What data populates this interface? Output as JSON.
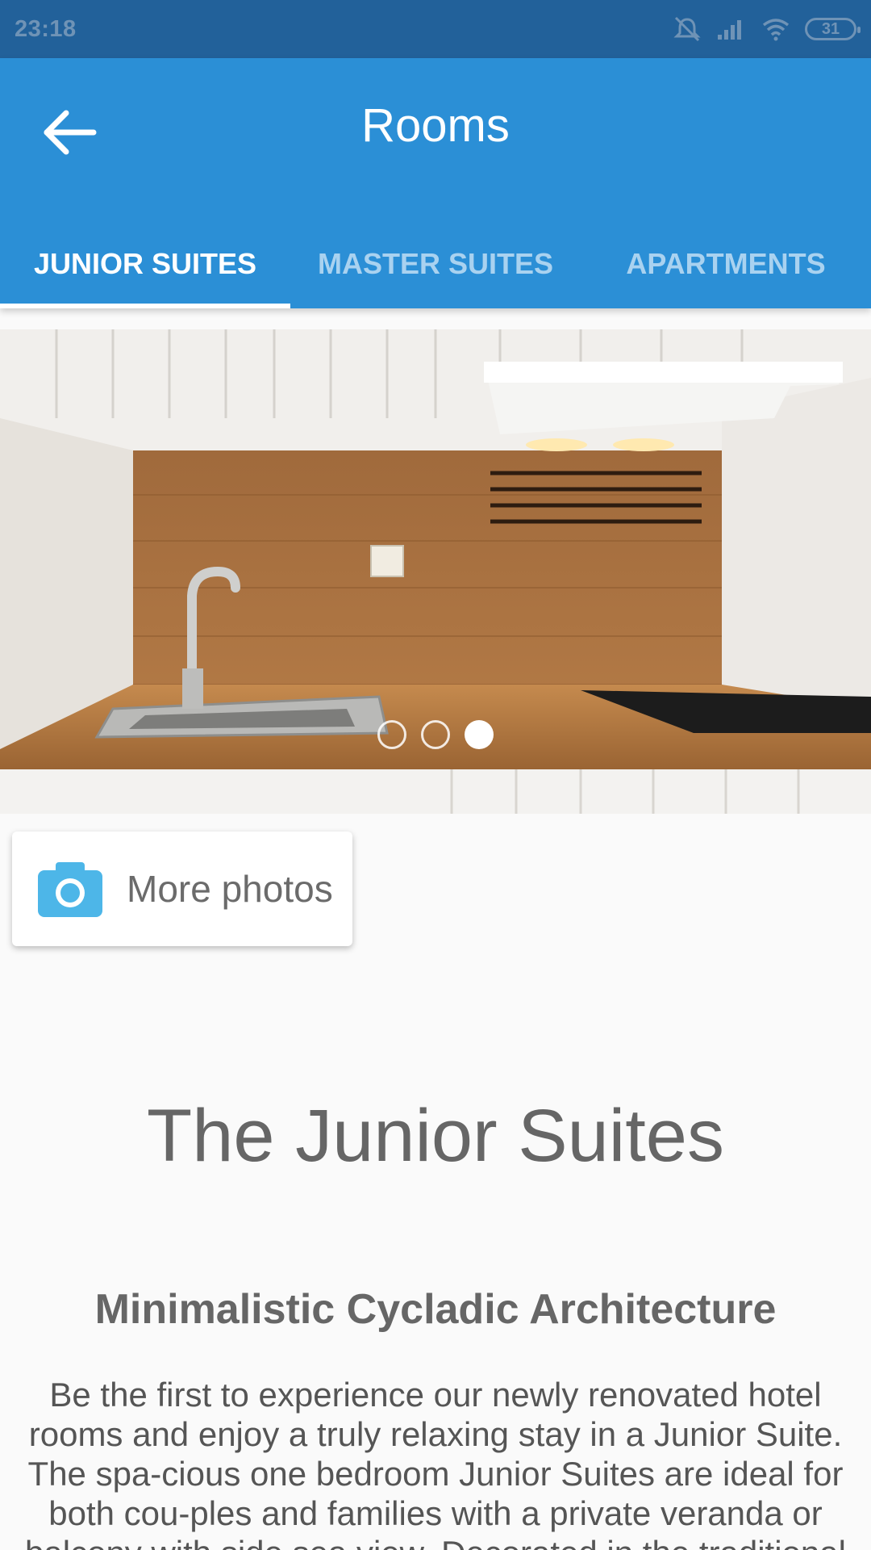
{
  "status_bar": {
    "time": "23:18",
    "battery": "31"
  },
  "app_bar": {
    "title": "Rooms"
  },
  "tabs": [
    {
      "label": "JUNIOR SUITES",
      "active": true
    },
    {
      "label": "MASTER SUITES",
      "active": false
    },
    {
      "label": "APARTMENTS",
      "active": false
    }
  ],
  "carousel": {
    "slide_count": 3,
    "active_index": 2
  },
  "more_photos": {
    "label": "More photos"
  },
  "room": {
    "title": "The Junior Suites",
    "subtitle": "Minimalistic Cycladic Architecture",
    "description": "Be the first to experience our newly renovated hotel rooms and enjoy a truly relaxing stay in a Junior Suite. The spa-cious one bedroom Junior Suites are ideal for both cou-ples and families with a private veranda or balcony with side sea view. Decorated in the traditional Cycladic style"
  },
  "colors": {
    "status_bar": "#22619a",
    "app_bar": "#2b8fd6",
    "accent": "#4db6e8"
  }
}
